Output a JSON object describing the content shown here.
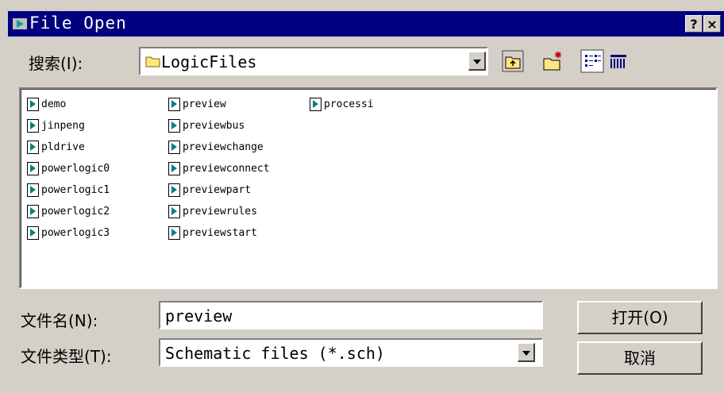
{
  "window": {
    "title": "File Open",
    "help_button": "?",
    "close_button": "×"
  },
  "look_in": {
    "label": "搜索(I):",
    "value": "LogicFiles"
  },
  "toolbar": {
    "up_folder_icon": "folder-up-icon",
    "new_folder_icon": "new-folder-icon",
    "list_view_icon": "list-view-icon",
    "details_view_icon": "details-view-icon"
  },
  "files": {
    "columns": [
      [
        "demo",
        "jinpeng",
        "pldrive",
        "powerlogic0",
        "powerlogic1",
        "powerlogic2",
        "powerlogic3"
      ],
      [
        "preview",
        "previewbus",
        "previewchange",
        "previewconnect",
        "previewpart",
        "previewrules",
        "previewstart"
      ],
      [
        "processi"
      ]
    ]
  },
  "filename": {
    "label": "文件名(N):",
    "value": "preview"
  },
  "filetype": {
    "label": "文件类型(T):",
    "value": "Schematic files (*.sch)"
  },
  "buttons": {
    "open": "打开(O)",
    "cancel": "取消"
  },
  "colors": {
    "titlebar": "#000080",
    "face": "#d4d0c8",
    "file_icon": "#008080"
  }
}
